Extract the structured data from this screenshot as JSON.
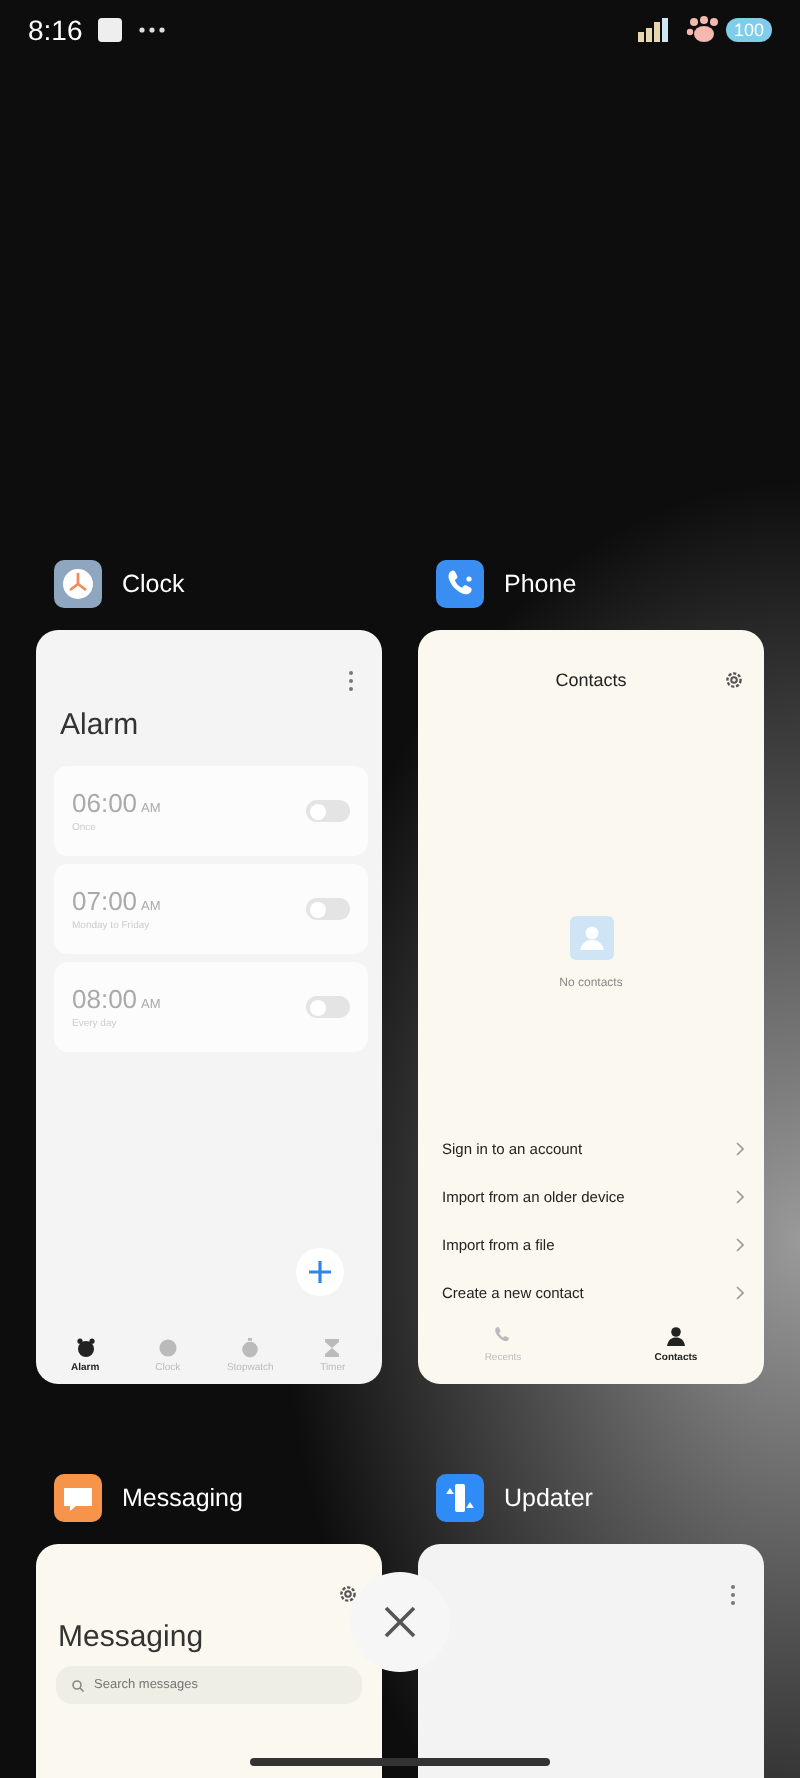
{
  "status_bar": {
    "time": "8:16",
    "battery": "100"
  },
  "tasks": [
    {
      "kind": "clock",
      "app_name": "Clock",
      "screen": {
        "title": "Alarm",
        "alarms": [
          {
            "time": "06:00",
            "period": "AM",
            "repeat": "Once",
            "on": false
          },
          {
            "time": "07:00",
            "period": "AM",
            "repeat": "Monday to Friday",
            "on": false
          },
          {
            "time": "08:00",
            "period": "AM",
            "repeat": "Every day",
            "on": false
          }
        ],
        "tabs": [
          {
            "label": "Alarm",
            "selected": true
          },
          {
            "label": "Clock",
            "selected": false
          },
          {
            "label": "Stopwatch",
            "selected": false
          },
          {
            "label": "Timer",
            "selected": false
          }
        ]
      }
    },
    {
      "kind": "phone",
      "app_name": "Phone",
      "screen": {
        "title": "Contacts",
        "empty_text": "No contacts",
        "actions": [
          "Sign in to an account",
          "Import from an older device",
          "Import from a file",
          "Create a new contact"
        ],
        "tabs": [
          {
            "label": "Recents",
            "selected": false
          },
          {
            "label": "Contacts",
            "selected": true
          }
        ]
      }
    },
    {
      "kind": "messaging",
      "app_name": "Messaging",
      "screen": {
        "title": "Messaging",
        "search": {
          "placeholder": "Search messages"
        }
      }
    },
    {
      "kind": "updater",
      "app_name": "Updater"
    }
  ]
}
